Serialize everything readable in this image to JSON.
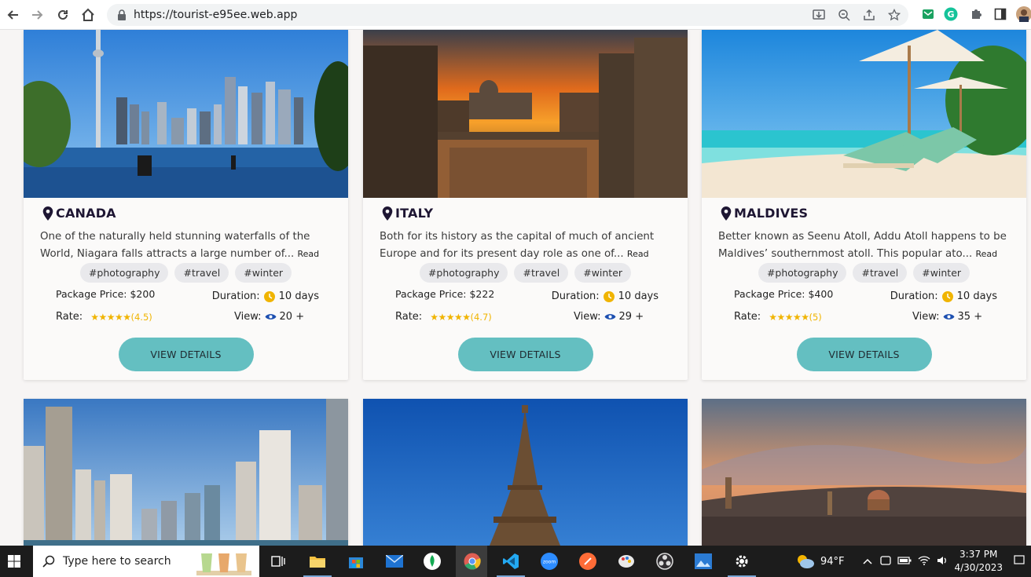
{
  "browser": {
    "url": "https://tourist-e95ee.web.app"
  },
  "cards": [
    {
      "country": "CANADA",
      "description": "One of the naturally held stunning waterfalls of the World, Niagara falls attracts a large number of...",
      "read_more": "Read More",
      "tags": [
        "#photography",
        "#travel",
        "#winter"
      ],
      "price": "Package Price: $200",
      "duration_label": "Duration:",
      "duration": "10 days",
      "rate_label": "Rate:",
      "stars": "★★★★★",
      "score": "(4.5)",
      "view_label": "View:",
      "views": "20 +",
      "button": "VIEW DETAILS"
    },
    {
      "country": "ITALY",
      "description": "Both for its history as the capital of much of ancient Europe and for its present day role as one of...",
      "read_more": "Read More",
      "tags": [
        "#photography",
        "#travel",
        "#winter"
      ],
      "price": "Package Price: $222",
      "duration_label": "Duration:",
      "duration": "10 days",
      "rate_label": "Rate:",
      "stars": "★★★★★",
      "score": "(4.7)",
      "view_label": "View:",
      "views": "29 +",
      "button": "VIEW DETAILS"
    },
    {
      "country": "MALDIVES",
      "description": "Better known as Seenu Atoll, Addu Atoll happens to be Maldives’ southernmost atoll. This popular ato...",
      "read_more": "Read More",
      "tags": [
        "#photography",
        "#travel",
        "#winter"
      ],
      "price": "Package Price: $400",
      "duration_label": "Duration:",
      "duration": "10 days",
      "rate_label": "Rate:",
      "stars": "★★★★★",
      "score": "(5)",
      "view_label": "View:",
      "views": "35 +",
      "button": "VIEW DETAILS"
    }
  ],
  "taskbar": {
    "search_placeholder": "Type here to search",
    "weather": "94°F",
    "time": "3:37 PM",
    "date": "4/30/2023"
  },
  "colors": {
    "accent_button": "#64bfc1",
    "star": "#f0b400",
    "title": "#1e1633"
  }
}
